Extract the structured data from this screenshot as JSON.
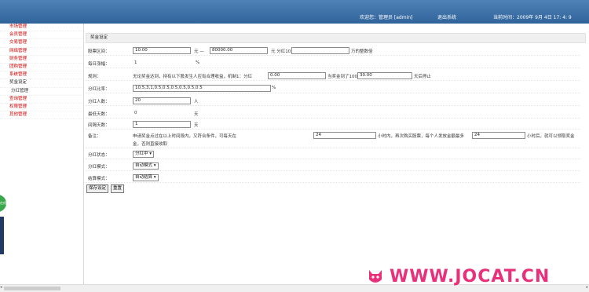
{
  "header": {
    "welcome": "欢迎您：管理员 [admin]",
    "logout": "退出系统",
    "time": "当前时间：2009年 9月 4日 17: 4: 9"
  },
  "sidebar": {
    "items": [
      {
        "label": "市场管理"
      },
      {
        "label": "会员管理"
      },
      {
        "label": "交易管理"
      },
      {
        "label": "网络管理"
      },
      {
        "label": "财务管理"
      },
      {
        "label": "团购管理"
      },
      {
        "label": "系统管理"
      },
      {
        "label": "奖金设定"
      },
      {
        "label": "分红管理"
      },
      {
        "label": "查询管理"
      },
      {
        "label": "权限管理"
      },
      {
        "label": "其他管理"
      }
    ],
    "float_label": "在线"
  },
  "panel": {
    "title": "奖金设定",
    "rows": {
      "price": {
        "label": "股票区间：",
        "from": "10.00",
        "sep": "元 —",
        "to": "80000.00",
        "unit_mid": "元 分红10",
        "unit_end": "万的整数倍"
      },
      "daily": {
        "label": "每日涨幅：",
        "value": "1",
        "unit": "%"
      },
      "rule": {
        "label": "规则：",
        "text": "无论奖金达到，持有以下股发生人应有合理收益，机制1：分红",
        "value1": "0.00",
        "mid": "当奖金到了100",
        "value2": "30.00",
        "end": "天后停止"
      },
      "ratio": {
        "label": "分红比率：",
        "value": "10,5,3,1,0.5,0.5,0.5,0.5,0.5,0.5",
        "unit": "%"
      },
      "people": {
        "label": "分红人数：",
        "value": "20",
        "unit": "人"
      },
      "days_min": {
        "label": "最低天数：",
        "value": "0",
        "unit": "天"
      },
      "days": {
        "label": "间隔天数：",
        "value": "1",
        "unit": "天"
      },
      "note": {
        "label": "备注：",
        "text1": "申请奖金点过在以上时间段内，又符合条件，可每天在",
        "value1": "24",
        "text2": "小时内，再次购买股票，每个人发放金额最多",
        "value2": "24",
        "text3": "小时后，就可以领取奖金",
        "text4": "金，否则直接收取"
      },
      "status": {
        "label": "分红状态：",
        "value": "分红中"
      },
      "mode": {
        "label": "分红模式：",
        "value": "自动模式"
      },
      "settle": {
        "label": "结算模式：",
        "value": "自动结算"
      }
    },
    "buttons": {
      "save": "保存设定",
      "reset": "重置"
    }
  },
  "watermark": "WWW.JOCAT.CN",
  "colors": {
    "header": "#3a6ea5",
    "menu_text": "#cc0000",
    "watermark": "#e8317a"
  }
}
